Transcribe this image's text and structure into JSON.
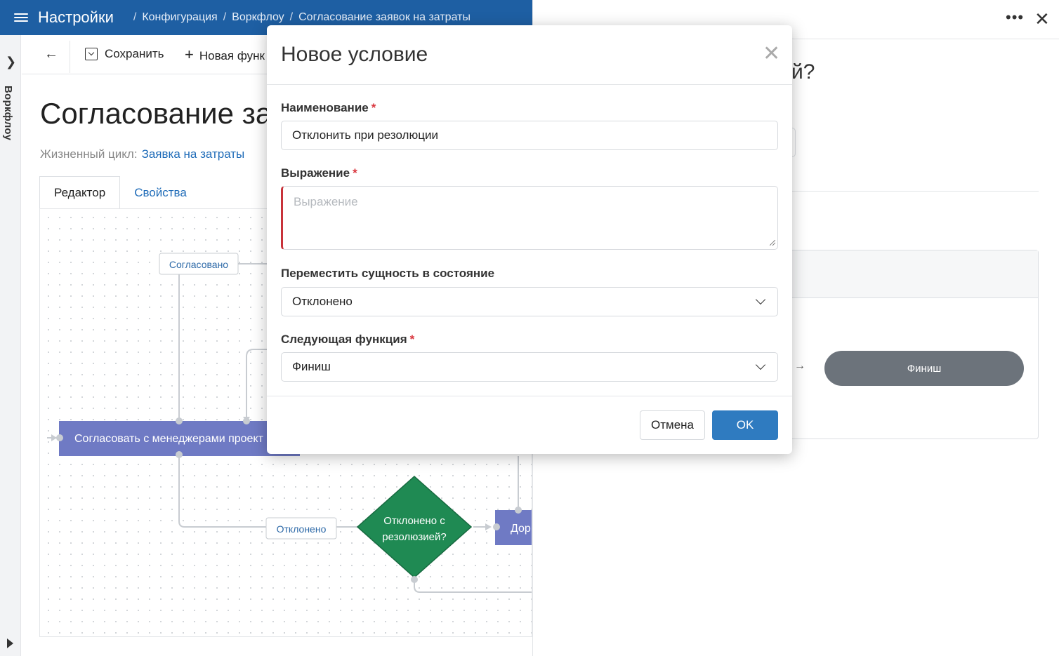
{
  "topbar": {
    "title": "Настройки",
    "breadcrumb": [
      "Конфигурация",
      "Воркфлоу",
      "Согласование заявок на затраты"
    ],
    "separator": "/"
  },
  "rail": {
    "label": "Воркфлоу"
  },
  "toolbar": {
    "save_label": "Сохранить",
    "new_label": "Новая функ"
  },
  "page": {
    "title": "Согласование зая",
    "lifecycle_label": "Жизненный цикл:",
    "lifecycle_value": "Заявка на затраты"
  },
  "tabs": [
    {
      "label": "Редактор",
      "active": true
    },
    {
      "label": "Свойства",
      "active": false
    }
  ],
  "diagram": {
    "label_approved": "Согласовано",
    "label_rejected": "Отклонено",
    "task_node": "Согласовать с менеджерами проект",
    "decision_node_line1": "Отклонено с",
    "decision_node_line2": "резолюзией?",
    "partial_node": "Дор",
    "colors": {
      "task": "#6f7ac4",
      "decision": "#1f8a53",
      "connector": "#c8ccd1"
    }
  },
  "right_panel": {
    "heading_tail": "й?",
    "finish_label": "Финиш",
    "arrow": "→",
    "menu_icon": "more-icon",
    "close_icon": "close-icon"
  },
  "modal": {
    "title": "Новое условие",
    "name_label": "Наименование",
    "name_value": "Отклонить при резолюции",
    "expression_label": "Выражение",
    "expression_placeholder": "Выражение",
    "state_label": "Переместить сущность в состояние",
    "state_value": "Отклонено",
    "next_label": "Следующая функция",
    "next_value": "Финиш",
    "required_mark": "*",
    "cancel_label": "Отмена",
    "ok_label": "OK"
  },
  "colors": {
    "brand": "#1e5fa3",
    "primary_button": "#2f7bc0",
    "required": "#d9363e",
    "link": "#1e6bb8"
  }
}
